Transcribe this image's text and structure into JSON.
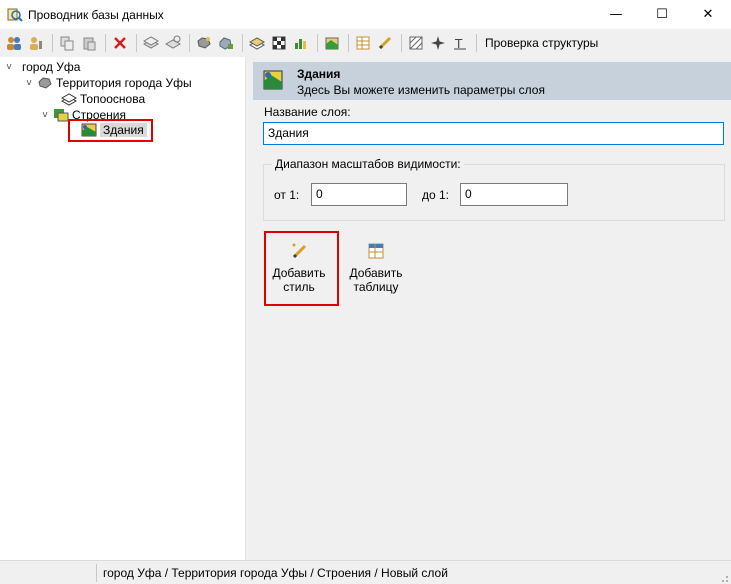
{
  "window": {
    "title": "Проводник базы данных",
    "minimize_glyph": "—",
    "maximize_glyph": "☐",
    "close_glyph": "✕"
  },
  "toolbar": {
    "check_structure_label": "Проверка структуры"
  },
  "tree": {
    "root": "город Уфа",
    "territory": "Территория города Уфы",
    "topo": "Топооснова",
    "buildings_group": "Строения",
    "buildings": "Здания"
  },
  "header": {
    "title": "Здания",
    "subtitle": "Здесь Вы можете изменить параметры слоя"
  },
  "form": {
    "layer_name_label": "Название слоя:",
    "layer_name_value": "Здания",
    "scale_group_title": "Диапазон масштабов видимости:",
    "from_label": "от 1:",
    "from_value": "0",
    "to_label": "до 1:",
    "to_value": "0"
  },
  "actions": {
    "add_style_line1": "Добавить",
    "add_style_line2": "стиль",
    "add_table_line1": "Добавить",
    "add_table_line2": "таблицу"
  },
  "statusbar": {
    "path": "город Уфа / Территория города Уфы / Строения / Новый слой"
  },
  "colors": {
    "header_bg": "#c6d1dc",
    "highlight": "#e00000",
    "focus_border": "#0078d7"
  }
}
